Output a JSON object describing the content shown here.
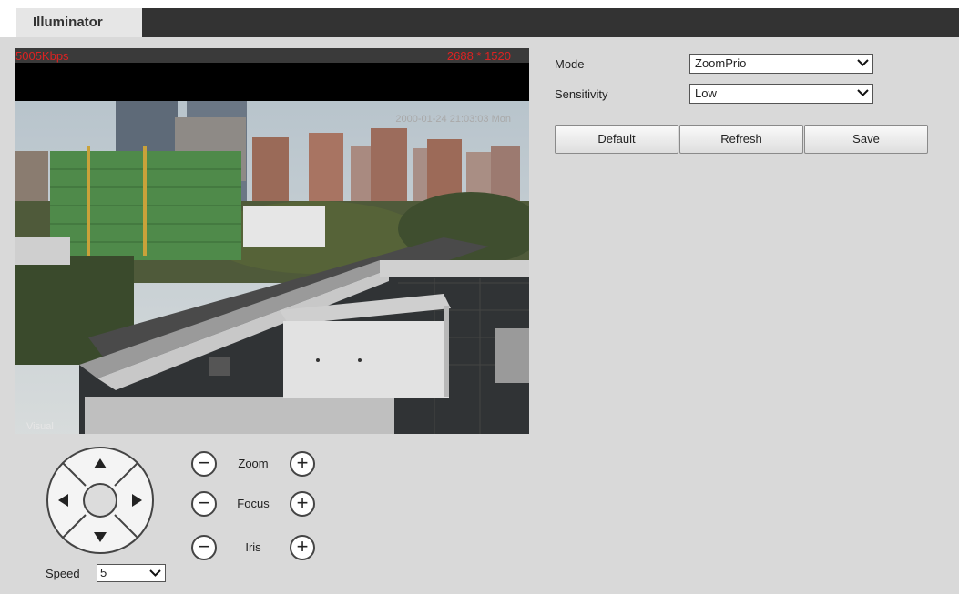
{
  "tab": {
    "label": "Illuminator"
  },
  "video": {
    "bitrate": "5005Kbps",
    "resolution": "2688 * 1520",
    "timestamp": "2000-01-24 21:03:03 Mon",
    "channel_label": "Visual"
  },
  "ptz": {
    "zoom_label": "Zoom",
    "focus_label": "Focus",
    "iris_label": "Iris",
    "speed_label": "Speed",
    "speed_value": "5"
  },
  "settings": {
    "mode_label": "Mode",
    "mode_value": "ZoomPrio",
    "sensitivity_label": "Sensitivity",
    "sensitivity_value": "Low"
  },
  "buttons": {
    "default_label": "Default",
    "refresh_label": "Refresh",
    "save_label": "Save"
  },
  "colors": {
    "osd_red": "#dd2222",
    "tab_bar": "#333333",
    "panel_bg": "#d9d9d9"
  }
}
